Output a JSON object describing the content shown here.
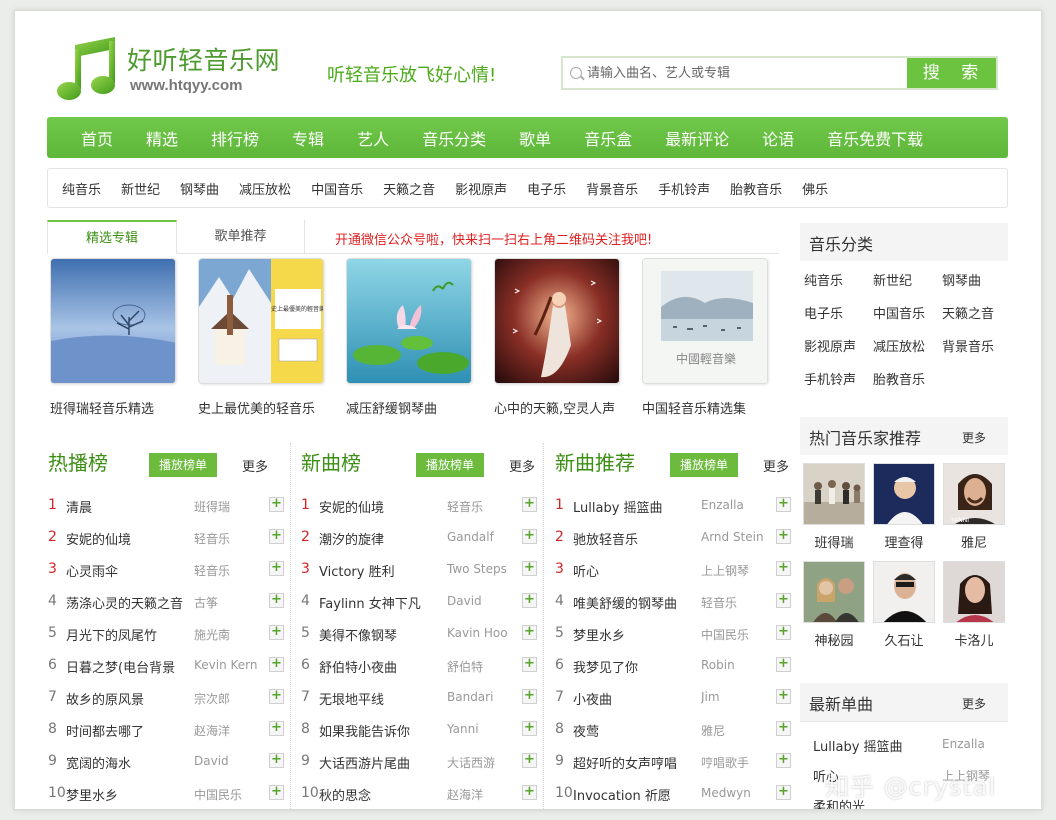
{
  "header": {
    "site_name": "好听轻音乐网",
    "site_url": "www.htqyy.com",
    "slogan": "听轻音乐放飞好心情!",
    "search_placeholder": "请输入曲名、艺人或专辑",
    "search_button": "搜 索"
  },
  "nav": [
    "首页",
    "精选",
    "排行榜",
    "专辑",
    "艺人",
    "音乐分类",
    "歌单",
    "音乐盒",
    "最新评论",
    "论语",
    "音乐免费下载"
  ],
  "subnav": [
    "纯音乐",
    "新世纪",
    "钢琴曲",
    "减压放松",
    "中国音乐",
    "天籁之音",
    "影视原声",
    "电子乐",
    "背景音乐",
    "手机铃声",
    "胎教音乐",
    "佛乐"
  ],
  "featured": {
    "tabs": [
      "精选专辑",
      "歌单推荐"
    ],
    "notice": "开通微信公众号啦，快来扫一扫右上角二维码关注我吧!",
    "albums": [
      {
        "title": "班得瑞轻音乐精选"
      },
      {
        "title": "史上最优美的轻音乐",
        "cover_text": "史上最優美的輕音樂"
      },
      {
        "title": "减压舒缓钢琴曲"
      },
      {
        "title": "心中的天籁,空灵人声"
      },
      {
        "title": "中国轻音乐精选集",
        "cover_text": "中國輕音樂"
      }
    ]
  },
  "charts": [
    {
      "title": "热播榜",
      "play_label": "播放榜单",
      "more_label": "更多",
      "rows": [
        {
          "rank": "1",
          "song": "清晨",
          "artist": "班得瑞"
        },
        {
          "rank": "2",
          "song": "安妮的仙境",
          "artist": "轻音乐"
        },
        {
          "rank": "3",
          "song": "心灵雨伞",
          "artist": "轻音乐"
        },
        {
          "rank": "4",
          "song": "荡涤心灵的天籁之音",
          "artist": "古筝"
        },
        {
          "rank": "5",
          "song": "月光下的凤尾竹",
          "artist": "施光南"
        },
        {
          "rank": "6",
          "song": "日暮之梦(电台背景",
          "artist": "Kevin Kern"
        },
        {
          "rank": "7",
          "song": "故乡的原风景",
          "artist": "宗次郎"
        },
        {
          "rank": "8",
          "song": "时间都去哪了",
          "artist": "赵海洋"
        },
        {
          "rank": "9",
          "song": "宽阔的海水",
          "artist": "David"
        },
        {
          "rank": "10",
          "song": "梦里水乡",
          "artist": "中国民乐"
        }
      ]
    },
    {
      "title": "新曲榜",
      "play_label": "播放榜单",
      "more_label": "更多",
      "rows": [
        {
          "rank": "1",
          "song": "安妮的仙境",
          "artist": "轻音乐"
        },
        {
          "rank": "2",
          "song": "潮汐的旋律",
          "artist": "Gandalf"
        },
        {
          "rank": "3",
          "song": "Victory 胜利",
          "artist": "Two Steps"
        },
        {
          "rank": "4",
          "song": "Faylinn 女神下凡",
          "artist": "David"
        },
        {
          "rank": "5",
          "song": "美得不像钢琴",
          "artist": "Kavin Hoo"
        },
        {
          "rank": "6",
          "song": "舒伯特小夜曲",
          "artist": "舒伯特"
        },
        {
          "rank": "7",
          "song": "无垠地平线",
          "artist": "Bandari"
        },
        {
          "rank": "8",
          "song": "如果我能告诉你",
          "artist": "Yanni"
        },
        {
          "rank": "9",
          "song": "大话西游片尾曲",
          "artist": "大话西游"
        },
        {
          "rank": "10",
          "song": "秋的思念",
          "artist": "赵海洋"
        }
      ]
    },
    {
      "title": "新曲推荐",
      "play_label": "播放榜单",
      "more_label": "更多",
      "rows": [
        {
          "rank": "1",
          "song": "Lullaby 摇篮曲",
          "artist": "Enzalla"
        },
        {
          "rank": "2",
          "song": "驰放轻音乐",
          "artist": "Arnd Stein"
        },
        {
          "rank": "3",
          "song": "听心",
          "artist": "上上钢琴"
        },
        {
          "rank": "4",
          "song": "唯美舒缓的钢琴曲",
          "artist": "轻音乐"
        },
        {
          "rank": "5",
          "song": "梦里水乡",
          "artist": "中国民乐"
        },
        {
          "rank": "6",
          "song": "我梦见了你",
          "artist": "Robin"
        },
        {
          "rank": "7",
          "song": "小夜曲",
          "artist": "Jim"
        },
        {
          "rank": "8",
          "song": "夜莺",
          "artist": "雅尼"
        },
        {
          "rank": "9",
          "song": "超好听的女声哼唱",
          "artist": "哼唱歌手"
        },
        {
          "rank": "10",
          "song": "Invocation 祈愿",
          "artist": "Medwyn"
        }
      ]
    }
  ],
  "sidebar": {
    "categories_title": "音乐分类",
    "categories": [
      "纯音乐",
      "新世纪",
      "钢琴曲",
      "电子乐",
      "中国音乐",
      "天籁之音",
      "影视原声",
      "减压放松",
      "背景音乐",
      "手机铃声",
      "胎教音乐"
    ],
    "artists_title": "热门音乐家推荐",
    "artists_more": "更多",
    "artists": [
      "班得瑞",
      "理查得",
      "雅尼",
      "神秘园",
      "久石让",
      "卡洛儿"
    ],
    "artist_pic_texts": [
      "YANNI"
    ],
    "singles_title": "最新单曲",
    "singles_more": "更多",
    "singles": [
      {
        "song": "Lullaby 摇篮曲",
        "artist": "Enzalla"
      },
      {
        "song": "听心",
        "artist": "上上钢琴"
      },
      {
        "song": "柔和的光",
        "artist": ""
      }
    ]
  },
  "watermark": "知乎 @crystal",
  "colors": {
    "brand_green": "#6cc33f",
    "title_green": "#3d8f14",
    "notice_red": "#e02020",
    "top_rank_red": "#d42424"
  }
}
